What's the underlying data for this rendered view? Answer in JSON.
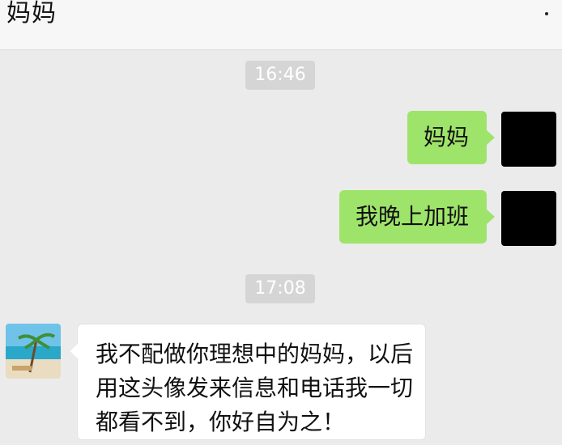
{
  "header": {
    "title": "妈妈",
    "more_icon": "more-dots-icon"
  },
  "timestamps": [
    "16:46",
    "17:08"
  ],
  "messages": [
    {
      "side": "right",
      "text": "妈妈"
    },
    {
      "side": "right",
      "text": "我晚上加班"
    },
    {
      "side": "left",
      "lines": [
        "我不配做你理想中的妈妈，以后",
        "用这头像发来信息和电话我一切",
        "都看不到，你好自为之！"
      ]
    }
  ],
  "colors": {
    "background": "#ebebeb",
    "header": "#f7f7f7",
    "sent_bubble": "#9fe46a",
    "received_bubble": "#ffffff",
    "timestamp_bg": "#d5d5d5"
  }
}
